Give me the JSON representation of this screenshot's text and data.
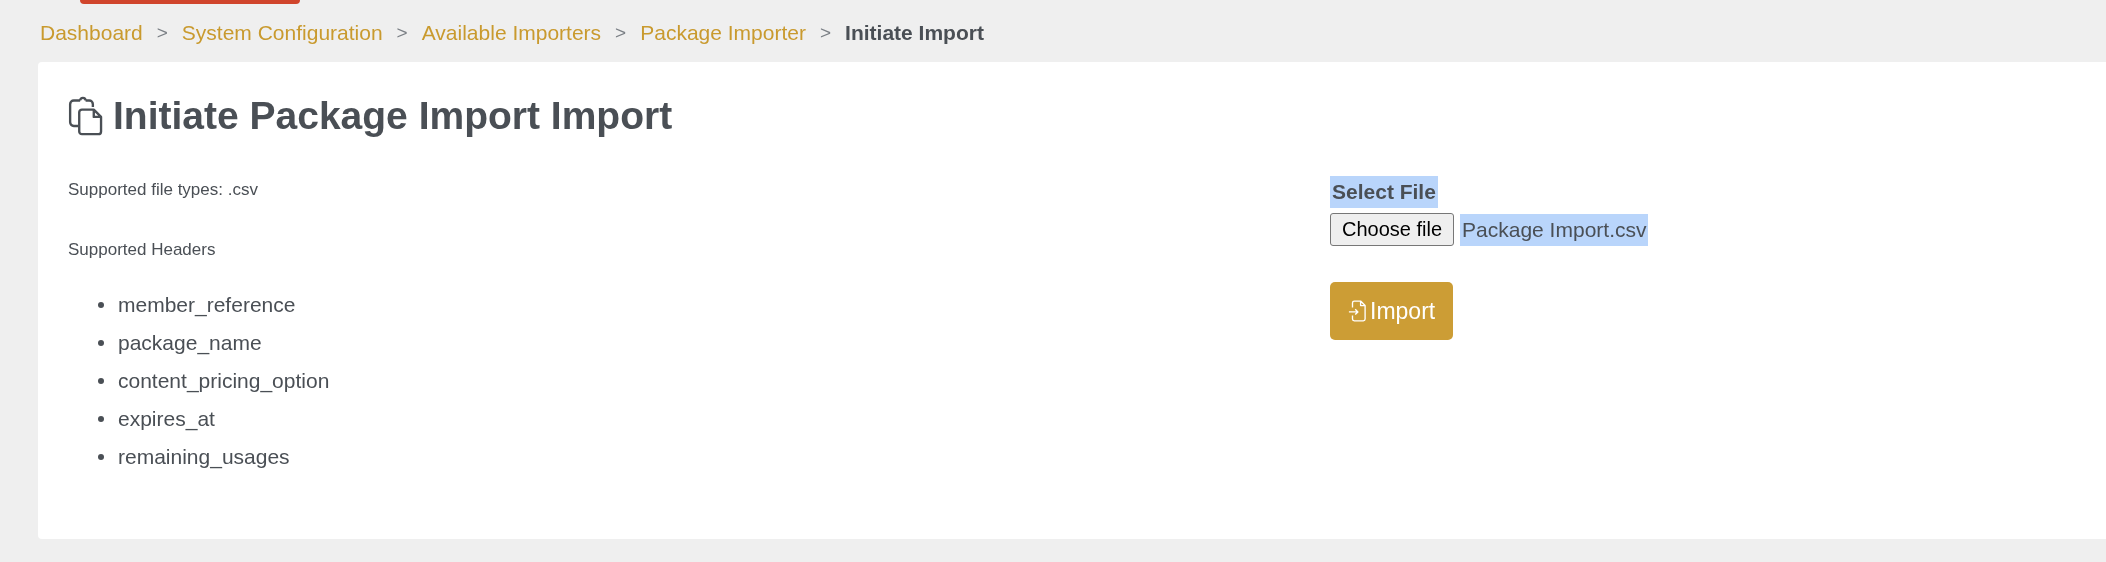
{
  "breadcrumb": [
    {
      "label": "Dashboard",
      "current": false
    },
    {
      "label": "System Configuration",
      "current": false
    },
    {
      "label": "Available Importers",
      "current": false
    },
    {
      "label": "Package Importer",
      "current": false
    },
    {
      "label": "Initiate Import",
      "current": true
    }
  ],
  "breadcrumb_separator": ">",
  "card": {
    "title": "Initiate Package Import Import",
    "file_types": "Supported file types: .csv",
    "headers_label": "Supported Headers",
    "headers": [
      "member_reference",
      "package_name",
      "content_pricing_option",
      "expires_at",
      "remaining_usages"
    ],
    "select_file": {
      "label": "Select File",
      "highlighted": true
    },
    "file_input": {
      "button": "Choose file",
      "file_name": "Package Import.csv",
      "highlighted": true
    },
    "import_button": "Import"
  }
}
